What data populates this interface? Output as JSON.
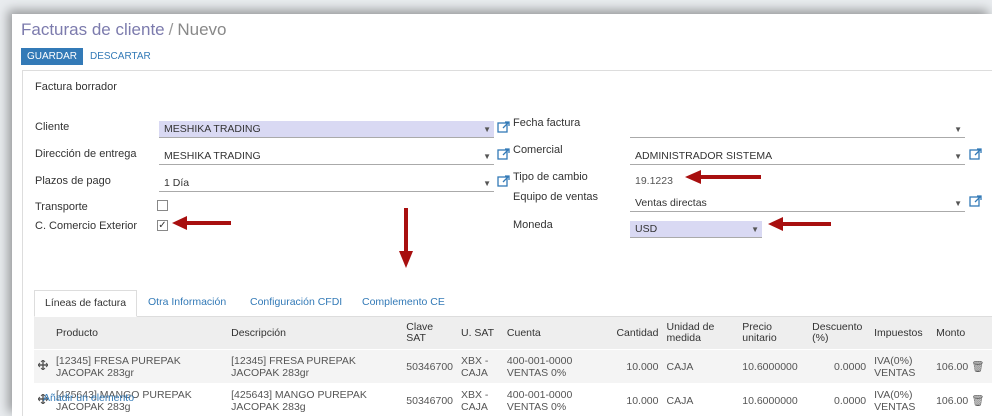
{
  "breadcrumb": {
    "parent": "Facturas de cliente",
    "separator": "/",
    "current": "Nuevo"
  },
  "toolbar": {
    "save_label": "GUARDAR",
    "discard_label": "DESCARTAR"
  },
  "status": "Factura borrador",
  "left_fields": {
    "cliente": {
      "label": "Cliente",
      "value": "MESHIKA TRADING"
    },
    "entrega": {
      "label": "Dirección de entrega",
      "value": "MESHIKA TRADING"
    },
    "plazos": {
      "label": "Plazos de pago",
      "value": "1 Día"
    },
    "transporte": {
      "label": "Transporte",
      "checked": false
    },
    "comercio": {
      "label": "C. Comercio Exterior",
      "checked": true,
      "mark": "✓"
    }
  },
  "right_fields": {
    "fecha": {
      "label": "Fecha factura",
      "value": ""
    },
    "comercial": {
      "label": "Comercial",
      "value": "ADMINISTRADOR SISTEMA"
    },
    "tipo_cambio": {
      "label": "Tipo de cambio",
      "value": "19.1223"
    },
    "equipo": {
      "label": "Equipo de ventas",
      "value": "Ventas directas"
    },
    "moneda": {
      "label": "Moneda",
      "value": "USD"
    }
  },
  "tabs": [
    {
      "label": "Líneas de factura"
    },
    {
      "label": "Otra Información"
    },
    {
      "label": "Configuración CFDI"
    },
    {
      "label": "Complemento CE"
    }
  ],
  "table": {
    "headers": [
      "Producto",
      "Descripción",
      "Clave SAT",
      "U. SAT",
      "Cuenta",
      "Cantidad",
      "Unidad de medida",
      "Precio unitario",
      "Descuento (%)",
      "Impuestos",
      "Monto"
    ],
    "rows": [
      {
        "producto": "[12345] FRESA PUREPAK JACOPAK 283gr",
        "descripcion": "[12345] FRESA PUREPAK JACOPAK 283gr",
        "clave": "50346700",
        "usat": "XBX - CAJA",
        "cuenta": "400-001-0000 VENTAS 0%",
        "cantidad": "10.000",
        "unidad": "CAJA",
        "precio": "10.6000000",
        "descuento": "0.0000",
        "impuestos": "IVA(0%) VENTAS",
        "monto": "106.00"
      },
      {
        "producto": "[425643] MANGO PUREPAK JACOPAK 283g",
        "descripcion": "[425643] MANGO PUREPAK JACOPAK 283g",
        "clave": "50346700",
        "usat": "XBX - CAJA",
        "cuenta": "400-001-0000 VENTAS 0%",
        "cantidad": "10.000",
        "unidad": "CAJA",
        "precio": "10.6000000",
        "descuento": "0.0000",
        "impuestos": "IVA(0%) VENTAS",
        "monto": "106.00"
      }
    ],
    "add_label": "Añadir un elemento"
  },
  "icons": {
    "move": "drag-handle-icon",
    "trash": "trash-icon",
    "external": "external-link-icon",
    "dropdown": "caret-down-icon"
  },
  "colors": {
    "primary": "#337ab7",
    "required_bg": "#d9d9f3",
    "annotation_arrow": "#a80f0f"
  }
}
